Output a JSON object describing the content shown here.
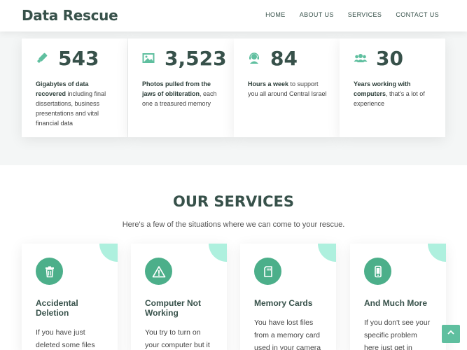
{
  "header": {
    "logo": "Data Rescue",
    "nav": [
      "HOME",
      "ABOUT US",
      "SERVICES",
      "CONTACT US"
    ]
  },
  "stats": [
    {
      "icon": "usb-stick-icon",
      "number": "543",
      "bold": "Gigabytes of data recovered",
      "rest": " including final dissertations, business presentations and vital financial data"
    },
    {
      "icon": "image-icon",
      "number": "3,523",
      "bold": "Photos pulled from the jaws of obliteration",
      "rest": ", each one a treasured memory"
    },
    {
      "icon": "headset-icon",
      "number": "84",
      "bold": "Hours a week",
      "rest": " to support you all around Central Israel"
    },
    {
      "icon": "users-icon",
      "number": "30",
      "bold": "Years working with computers",
      "rest": ", that's a lot of experience"
    }
  ],
  "services": {
    "title": "OUR SERVICES",
    "subtitle": "Here's a few of the situations where we can come to your rescue.",
    "cards": [
      {
        "icon": "trash-icon",
        "title": "Accidental Deletion",
        "text": "If you have just deleted some files"
      },
      {
        "icon": "warning-icon",
        "title": "Computer Not Working",
        "text": "You try to turn on your computer but it"
      },
      {
        "icon": "memory-card-icon",
        "title": "Memory Cards",
        "text": "You have lost files from a memory card used in your camera"
      },
      {
        "icon": "phone-icon",
        "title": "And Much More",
        "text": "If you don't see your specific problem here just get in touch"
      }
    ]
  },
  "colors": {
    "accent": "#5fbf9f",
    "dark": "#37514a",
    "corner": "#aef0de"
  }
}
